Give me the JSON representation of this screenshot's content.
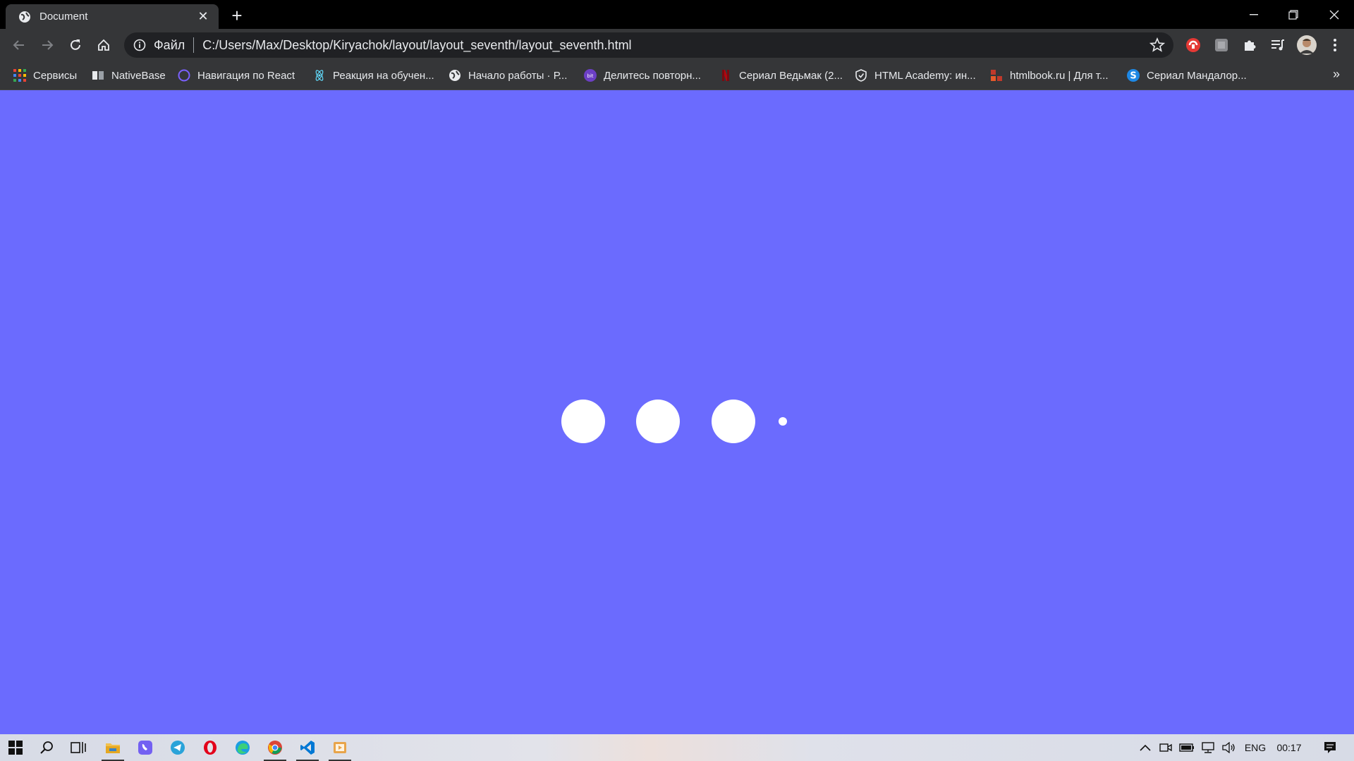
{
  "browser": {
    "tab": {
      "title": "Document",
      "icon": "globe-icon"
    },
    "address": {
      "scheme_label": "Файл",
      "url": "C:/Users/Max/Desktop/Kiryachok/layout/layout_seventh/layout_seventh.html"
    },
    "bookmarks": [
      {
        "label": "Сервисы",
        "icon": "apps-grid-icon"
      },
      {
        "label": "NativeBase",
        "icon": "nativebase-icon"
      },
      {
        "label": "Навигация по React",
        "icon": "react-navigation-icon"
      },
      {
        "label": "Реакция на обучен...",
        "icon": "react-icon"
      },
      {
        "label": "Начало работы · Р...",
        "icon": "globe-icon"
      },
      {
        "label": "Делитесь повторн...",
        "icon": "bit-icon"
      },
      {
        "label": "Сериал Ведьмак (2...",
        "icon": "netflix-icon"
      },
      {
        "label": "HTML Academy: ин...",
        "icon": "shield-icon"
      },
      {
        "label": "htmlbook.ru | Для т...",
        "icon": "htmlbook-icon"
      },
      {
        "label": "Сериал Мандалор...",
        "icon": "s-icon"
      }
    ],
    "more_label": "»"
  },
  "page": {
    "background": "#6b6bfe",
    "dot_color": "#ffffff",
    "dots": [
      "dot-1",
      "dot-2",
      "dot-3",
      "dot-small"
    ]
  },
  "taskbar": {
    "language": "ENG",
    "time": "00:17"
  }
}
